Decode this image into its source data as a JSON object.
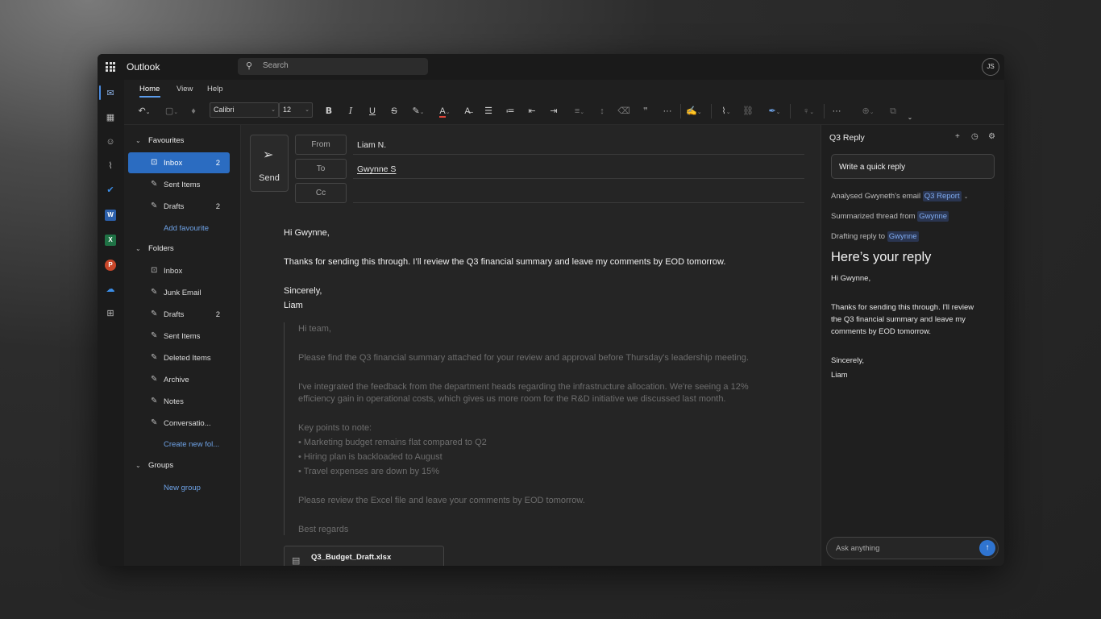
{
  "app": {
    "title": "Outlook",
    "search_placeholder": "Search",
    "avatar_initials": "JS"
  },
  "ribbon": {
    "tabs": [
      {
        "label": "Home"
      },
      {
        "label": "View"
      },
      {
        "label": "Help"
      }
    ],
    "font_name": "Calibri",
    "font_size": "12"
  },
  "folders": {
    "favourites_label": "Favourites",
    "favourites": [
      {
        "label": "Inbox",
        "count": "2"
      },
      {
        "label": "Sent Items",
        "count": ""
      },
      {
        "label": "Drafts",
        "count": "2"
      }
    ],
    "add_favourite": "Add favourite",
    "folders_label": "Folders",
    "items": [
      {
        "label": "Inbox",
        "count": ""
      },
      {
        "label": "Junk Email",
        "count": ""
      },
      {
        "label": "Drafts",
        "count": "2"
      },
      {
        "label": "Sent Items",
        "count": ""
      },
      {
        "label": "Deleted Items",
        "count": ""
      },
      {
        "label": "Archive",
        "count": ""
      },
      {
        "label": "Notes",
        "count": ""
      },
      {
        "label": "Conversatio...",
        "count": ""
      }
    ],
    "create_new_folder": "Create new fol...",
    "groups_label": "Groups",
    "new_group": "New group"
  },
  "compose": {
    "send_label": "Send",
    "from_label": "From",
    "from_value": "Liam N.",
    "to_label": "To",
    "to_value": "Gwynne S",
    "cc_label": "Cc",
    "cc_value": "",
    "body": {
      "greeting": "Hi Gwynne,",
      "message": "Thanks for sending this through. I’ll review the Q3 financial summary and leave my comments by EOD tomorrow.",
      "signoff": "Sincerely,",
      "name": "Liam"
    },
    "quoted": {
      "greeting": "Hi team,",
      "p1": "Please find the Q3 financial summary attached for your review and approval before Thursday's leadership meeting.",
      "p2a": "I've integrated the feedback from the department heads regarding the infrastructure allocation. We're seeing a 12%",
      "p2b": "efficiency gain in operational costs, which gives us more room for the R&D initiative we discussed last month.",
      "points_header": "Key points to note:",
      "point1": "• Marketing budget remains flat compared to Q2",
      "point2": "• Hiring plan is backloaded to August",
      "point3": "• Travel expenses are down by 15%",
      "p3": "Please review the Excel file and leave your comments by EOD tomorrow.",
      "closing": "Best regards"
    },
    "attachment_name": "Q3_Budget_Draft.xlsx"
  },
  "copilot": {
    "title": "Q3 Reply",
    "quick_reply": "Write a quick reply",
    "step1_text": "Analysed Gwyneth's email",
    "step1_chip": "Q3 Report",
    "step2_text": "Summarized thread from",
    "step2_chip": "Gwynne",
    "step3_text": "Drafting reply to",
    "step3_chip": "Gwynne",
    "heading": "Here’s your reply",
    "reply_greeting": "Hi Gwynne,",
    "reply_line1": "Thanks for sending this through. I'll review",
    "reply_line2": "the Q3 financial summary and leave my",
    "reply_line3": "comments by EOD tomorrow.",
    "reply_signoff": "Sincerely,",
    "reply_name": "Liam",
    "ask_placeholder": "Ask anything"
  },
  "colors": {
    "accent": "#2b6cc1",
    "link": "#6ea2e6",
    "send": "#2f74d0"
  }
}
